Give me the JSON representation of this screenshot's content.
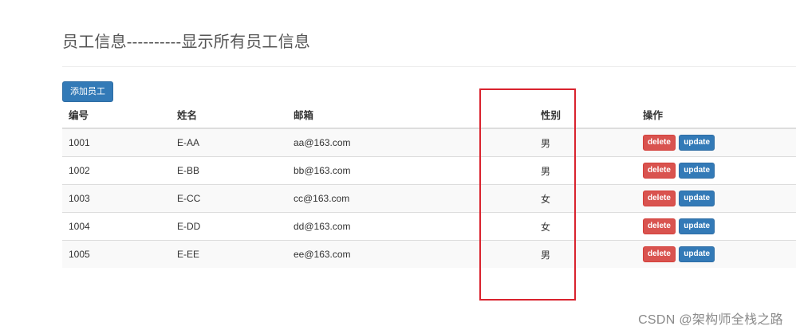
{
  "page": {
    "title": "员工信息----------显示所有员工信息"
  },
  "toolbar": {
    "add_label": "添加员工"
  },
  "table": {
    "headers": {
      "id": "编号",
      "name": "姓名",
      "email": "邮箱",
      "gender": "性别",
      "actions": "操作"
    },
    "rows": [
      {
        "id": "1001",
        "name": "E-AA",
        "email": "aa@163.com",
        "gender": "男"
      },
      {
        "id": "1002",
        "name": "E-BB",
        "email": "bb@163.com",
        "gender": "男"
      },
      {
        "id": "1003",
        "name": "E-CC",
        "email": "cc@163.com",
        "gender": "女"
      },
      {
        "id": "1004",
        "name": "E-DD",
        "email": "dd@163.com",
        "gender": "女"
      },
      {
        "id": "1005",
        "name": "E-EE",
        "email": "ee@163.com",
        "gender": "男"
      }
    ],
    "delete_label": "delete",
    "update_label": "update"
  },
  "watermark": "CSDN @架构师全栈之路",
  "colors": {
    "primary": "#337ab7",
    "danger": "#d9534f",
    "highlight": "#d9232e"
  }
}
